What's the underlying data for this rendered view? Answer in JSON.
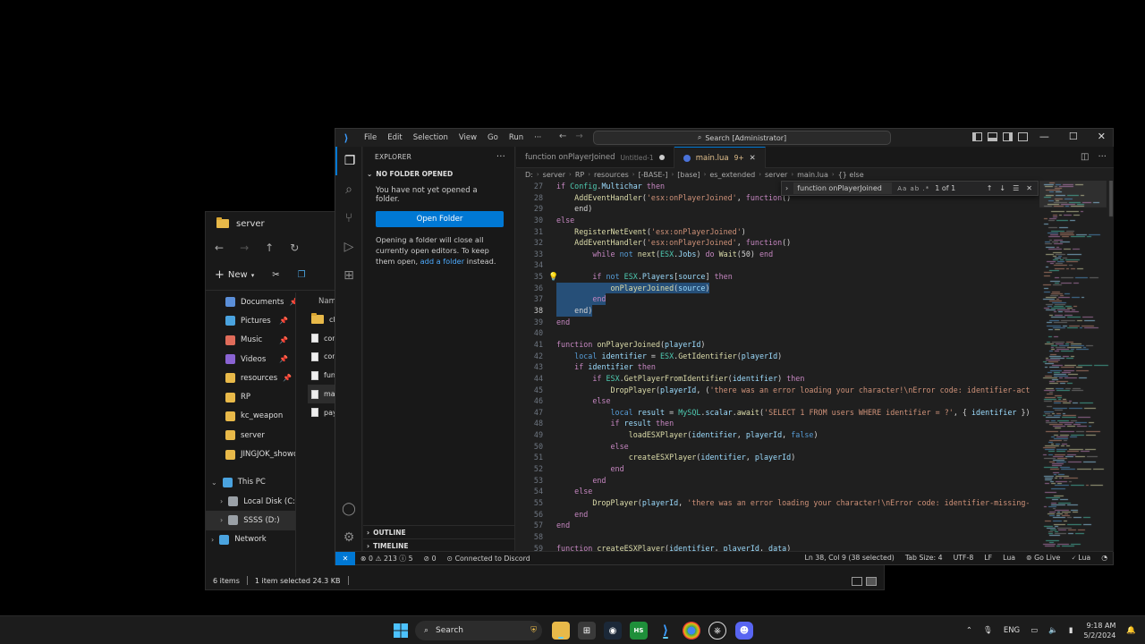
{
  "explorer": {
    "title": "server",
    "new_label": "New",
    "sidebar": [
      {
        "label": "Documents",
        "pinned": true,
        "color": "#5b8fd9"
      },
      {
        "label": "Pictures",
        "pinned": true,
        "color": "#4aa3df"
      },
      {
        "label": "Music",
        "pinned": true,
        "color": "#e06c5a"
      },
      {
        "label": "Videos",
        "pinned": true,
        "color": "#8a63d2"
      },
      {
        "label": "resources",
        "pinned": true,
        "color": "#e8b949"
      },
      {
        "label": "RP",
        "pinned": false,
        "color": "#e8b949"
      },
      {
        "label": "kc_weapon",
        "pinned": false,
        "color": "#e8b949"
      },
      {
        "label": "server",
        "pinned": false,
        "color": "#e8b949"
      },
      {
        "label": "JINGJOK_showd",
        "pinned": false,
        "color": "#e8b949"
      }
    ],
    "tree": [
      {
        "label": "This PC",
        "indent": 0,
        "color": "#4aa3df",
        "selected": false
      },
      {
        "label": "Local Disk (C:)",
        "indent": 1,
        "color": "#9aa0a6",
        "selected": false
      },
      {
        "label": "SSSS (D:)",
        "indent": 1,
        "color": "#9aa0a6",
        "selected": true
      },
      {
        "label": "Network",
        "indent": 0,
        "color": "#4aa3df",
        "selected": false
      }
    ],
    "list_header": "Nam",
    "files": [
      {
        "name": "clas",
        "kind": "folder",
        "selected": false
      },
      {
        "name": "con",
        "kind": "file",
        "selected": false
      },
      {
        "name": "con",
        "kind": "file",
        "selected": false
      },
      {
        "name": "fun",
        "kind": "file",
        "selected": false
      },
      {
        "name": "mai",
        "kind": "file",
        "selected": true
      },
      {
        "name": "pay",
        "kind": "file",
        "selected": false
      }
    ],
    "status_items": "6 items",
    "status_selected": "1 item selected  24.3 KB"
  },
  "vscode": {
    "menu": [
      "File",
      "Edit",
      "Selection",
      "View",
      "Go",
      "Run",
      "···"
    ],
    "search_text": "Search [Administrator]",
    "explorer_title": "EXPLORER",
    "no_folder": "NO FOLDER OPENED",
    "no_folder_msg": "You have not yet opened a folder.",
    "open_folder_label": "Open Folder",
    "open_msg_prefix": "Opening a folder will close all currently open editors. To keep them open, ",
    "open_msg_link": "add a folder",
    "open_msg_suffix": " instead.",
    "outline_label": "OUTLINE",
    "timeline_label": "TIMELINE",
    "tabs": [
      {
        "label": "function onPlayerJoined",
        "sub": "Untitled-1",
        "active": false
      },
      {
        "label": "main.lua",
        "sub": "9+",
        "active": true
      }
    ],
    "breadcrumb": [
      "D:",
      "server",
      "RP",
      "resources",
      "[-BASE-]",
      "[base]",
      "es_extended",
      "server",
      "main.lua",
      "{} else"
    ],
    "find_query": "function onPlayerJoined",
    "find_opts": "Aa ab .*",
    "find_result": "1 of 1",
    "status": {
      "errors": "0",
      "warnings": "213",
      "infos": "5",
      "ports": "0",
      "discord": "Connected to Discord",
      "position": "Ln 38, Col 9 (38 selected)",
      "tab_size": "Tab Size: 4",
      "encoding": "UTF-8",
      "eol": "LF",
      "language": "Lua",
      "live": "Go Live",
      "lua": "Lua"
    }
  },
  "taskbar": {
    "search_label": "Search",
    "lang": "ENG",
    "time": "9:18 AM",
    "date": "5/2/2024"
  }
}
